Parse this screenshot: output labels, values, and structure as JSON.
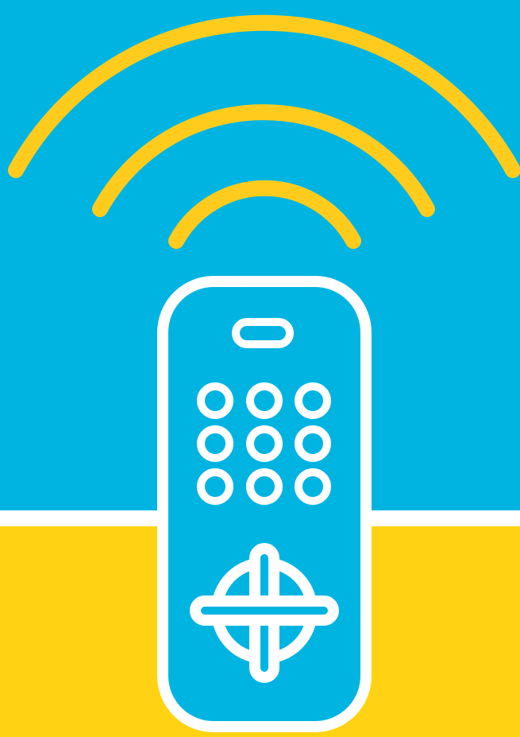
{
  "illustration": {
    "subject": "remote-control-icon",
    "signal_icon": "wifi-signal-icon",
    "colors": {
      "sky_blue": "#00B4E1",
      "yellow": "#FFD314",
      "white": "#FFFFFF",
      "signal_yellow": "#FFCC1E"
    },
    "signal_arcs": 3,
    "keypad": {
      "rows": 3,
      "columns": 3
    }
  }
}
